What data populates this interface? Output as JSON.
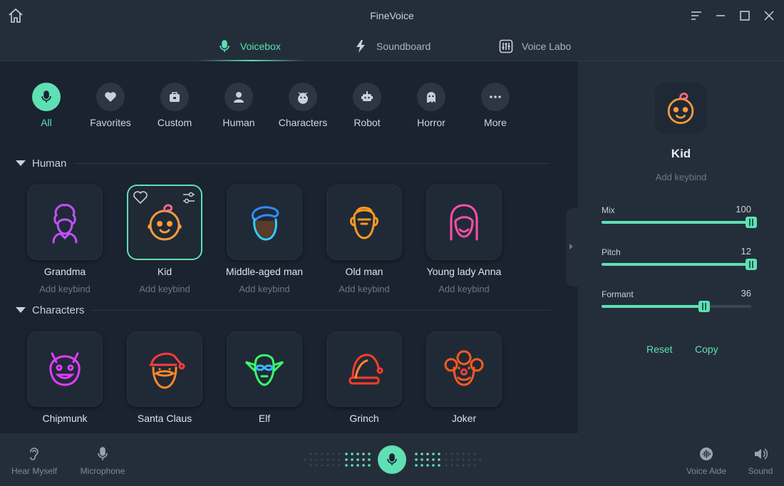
{
  "window": {
    "title": "FineVoice",
    "icons": {
      "home": "home-icon",
      "menu": "menu-icon",
      "minimize": "minimize-icon",
      "maximize": "maximize-icon",
      "close": "close-icon"
    }
  },
  "tabs": [
    {
      "label": "Voicebox",
      "icon": "microphone-icon",
      "active": true
    },
    {
      "label": "Soundboard",
      "icon": "lightning-icon",
      "active": false
    },
    {
      "label": "Voice Labo",
      "icon": "equalizer-icon",
      "active": false
    }
  ],
  "categories": [
    {
      "label": "All",
      "icon": "microphone-icon",
      "active": true
    },
    {
      "label": "Favorites",
      "icon": "heart-icon"
    },
    {
      "label": "Custom",
      "icon": "briefcase-icon"
    },
    {
      "label": "Human",
      "icon": "person-icon"
    },
    {
      "label": "Characters",
      "icon": "devil-icon"
    },
    {
      "label": "Robot",
      "icon": "robot-icon"
    },
    {
      "label": "Horror",
      "icon": "ghost-icon"
    },
    {
      "label": "More",
      "icon": "more-dots-icon"
    }
  ],
  "sections": {
    "human": {
      "title": "Human",
      "voices": [
        {
          "name": "Grandma",
          "keybind": "Add keybind",
          "icon": "grandma-icon",
          "color": "#c450ff"
        },
        {
          "name": "Kid",
          "keybind": "Add keybind",
          "icon": "baby-icon",
          "color": "#ff9a3c",
          "selected": true
        },
        {
          "name": "Middle-aged man",
          "keybind": "Add keybind",
          "icon": "man-icon",
          "color": "#33cfff"
        },
        {
          "name": "Old man",
          "keybind": "Add keybind",
          "icon": "old-man-icon",
          "color": "#ff9a1f"
        },
        {
          "name": "Young lady Anna",
          "keybind": "Add keybind",
          "icon": "lady-icon",
          "color": "#ff4fae"
        }
      ]
    },
    "characters": {
      "title": "Characters",
      "voices": [
        {
          "name": "Chipmunk",
          "icon": "chipmunk-icon",
          "color": "#e23cff"
        },
        {
          "name": "Santa Claus",
          "icon": "santa-icon",
          "color": "#ff3c3c"
        },
        {
          "name": "Elf",
          "icon": "elf-icon",
          "color": "#3cff6a"
        },
        {
          "name": "Grinch",
          "icon": "grinch-hat-icon",
          "color": "#ff3c2a"
        },
        {
          "name": "Joker",
          "icon": "joker-icon",
          "color": "#ff5a1f"
        }
      ]
    }
  },
  "panel": {
    "selected_name": "Kid",
    "keybind": "Add keybind",
    "sliders": [
      {
        "label": "Mix",
        "value": "100",
        "fraction": 1.0
      },
      {
        "label": "Pitch",
        "value": "12",
        "fraction": 1.0
      },
      {
        "label": "Formant",
        "value": "36",
        "fraction": 0.67
      }
    ],
    "reset_label": "Reset",
    "copy_label": "Copy"
  },
  "bottom": {
    "hear_myself": "Hear Myself",
    "microphone": "Microphone",
    "voice_aide": "Voice Aide",
    "sound": "Sound"
  },
  "colors": {
    "accent": "#5fe0b4",
    "background": "#1a232f",
    "panel": "#242e3a"
  }
}
